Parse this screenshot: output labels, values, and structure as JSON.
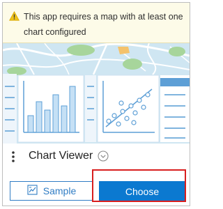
{
  "warning": {
    "icon": "warning-icon",
    "text": "This app requires a map with at least one chart configured"
  },
  "thumbnail": {
    "description_icons": [
      "bar-chart-icon",
      "scatter-chart-icon",
      "list-panel-icon",
      "map-background"
    ]
  },
  "app": {
    "title": "Chart Viewer",
    "menu_icon": "kebab-menu-icon",
    "info_icon": "chevron-down-circle-icon"
  },
  "actions": {
    "sample_label": "Sample",
    "sample_icon": "sample-image-icon",
    "choose_label": "Choose"
  },
  "colors": {
    "accent": "#0b79d0",
    "warning_bg": "#fdfbe8",
    "warning_icon": "#f0c419",
    "highlight": "#d81e1e"
  }
}
